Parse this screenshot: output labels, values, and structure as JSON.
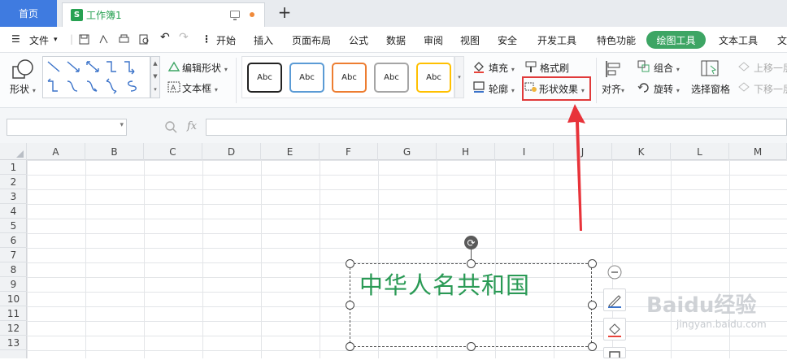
{
  "tabs": {
    "home": "首页",
    "doc_title": "工作簿1",
    "doc_icon_letter": "S"
  },
  "menu": {
    "file": "文件",
    "items": [
      "开始",
      "插入",
      "页面布局",
      "公式",
      "数据",
      "审阅",
      "视图",
      "安全",
      "开发工具",
      "特色功能"
    ],
    "drawing_tool": "绘图工具",
    "text_tool": "文本工具",
    "more": "文"
  },
  "ribbon": {
    "shape": "形状",
    "edit_shape": "编辑形状",
    "text_box": "文本框",
    "styles": [
      "Abc",
      "Abc",
      "Abc",
      "Abc",
      "Abc"
    ],
    "style_colors": [
      "#222222",
      "#5b9bd5",
      "#ed7d31",
      "#a5a5a5",
      "#ffc000"
    ],
    "fill": "填充",
    "format_painter": "格式刷",
    "outline": "轮廓",
    "shape_effects": "形状效果",
    "align": "对齐",
    "group": "组合",
    "rotate": "旋转",
    "selection_pane": "选择窗格",
    "bring_forward": "上移一层",
    "send_backward": "下移一层"
  },
  "formula": {
    "fx": "fx",
    "name_box": "",
    "content": ""
  },
  "columns": [
    "A",
    "B",
    "C",
    "D",
    "E",
    "F",
    "G",
    "H",
    "I",
    "J",
    "K",
    "L",
    "M"
  ],
  "rows": [
    "1",
    "2",
    "3",
    "4",
    "5",
    "6",
    "7",
    "8",
    "9",
    "10",
    "11",
    "12",
    "13"
  ],
  "textbox": {
    "text": "中华人名共和国",
    "color": "#2a9a55"
  },
  "watermark": {
    "main": "Baidu经验",
    "sub": "jingyan.baidu.com"
  },
  "colors": {
    "accent_green": "#3da564",
    "home_tab_blue": "#3f7be0",
    "highlight_red": "#e03a3a",
    "arrow_red": "#e8333a"
  }
}
